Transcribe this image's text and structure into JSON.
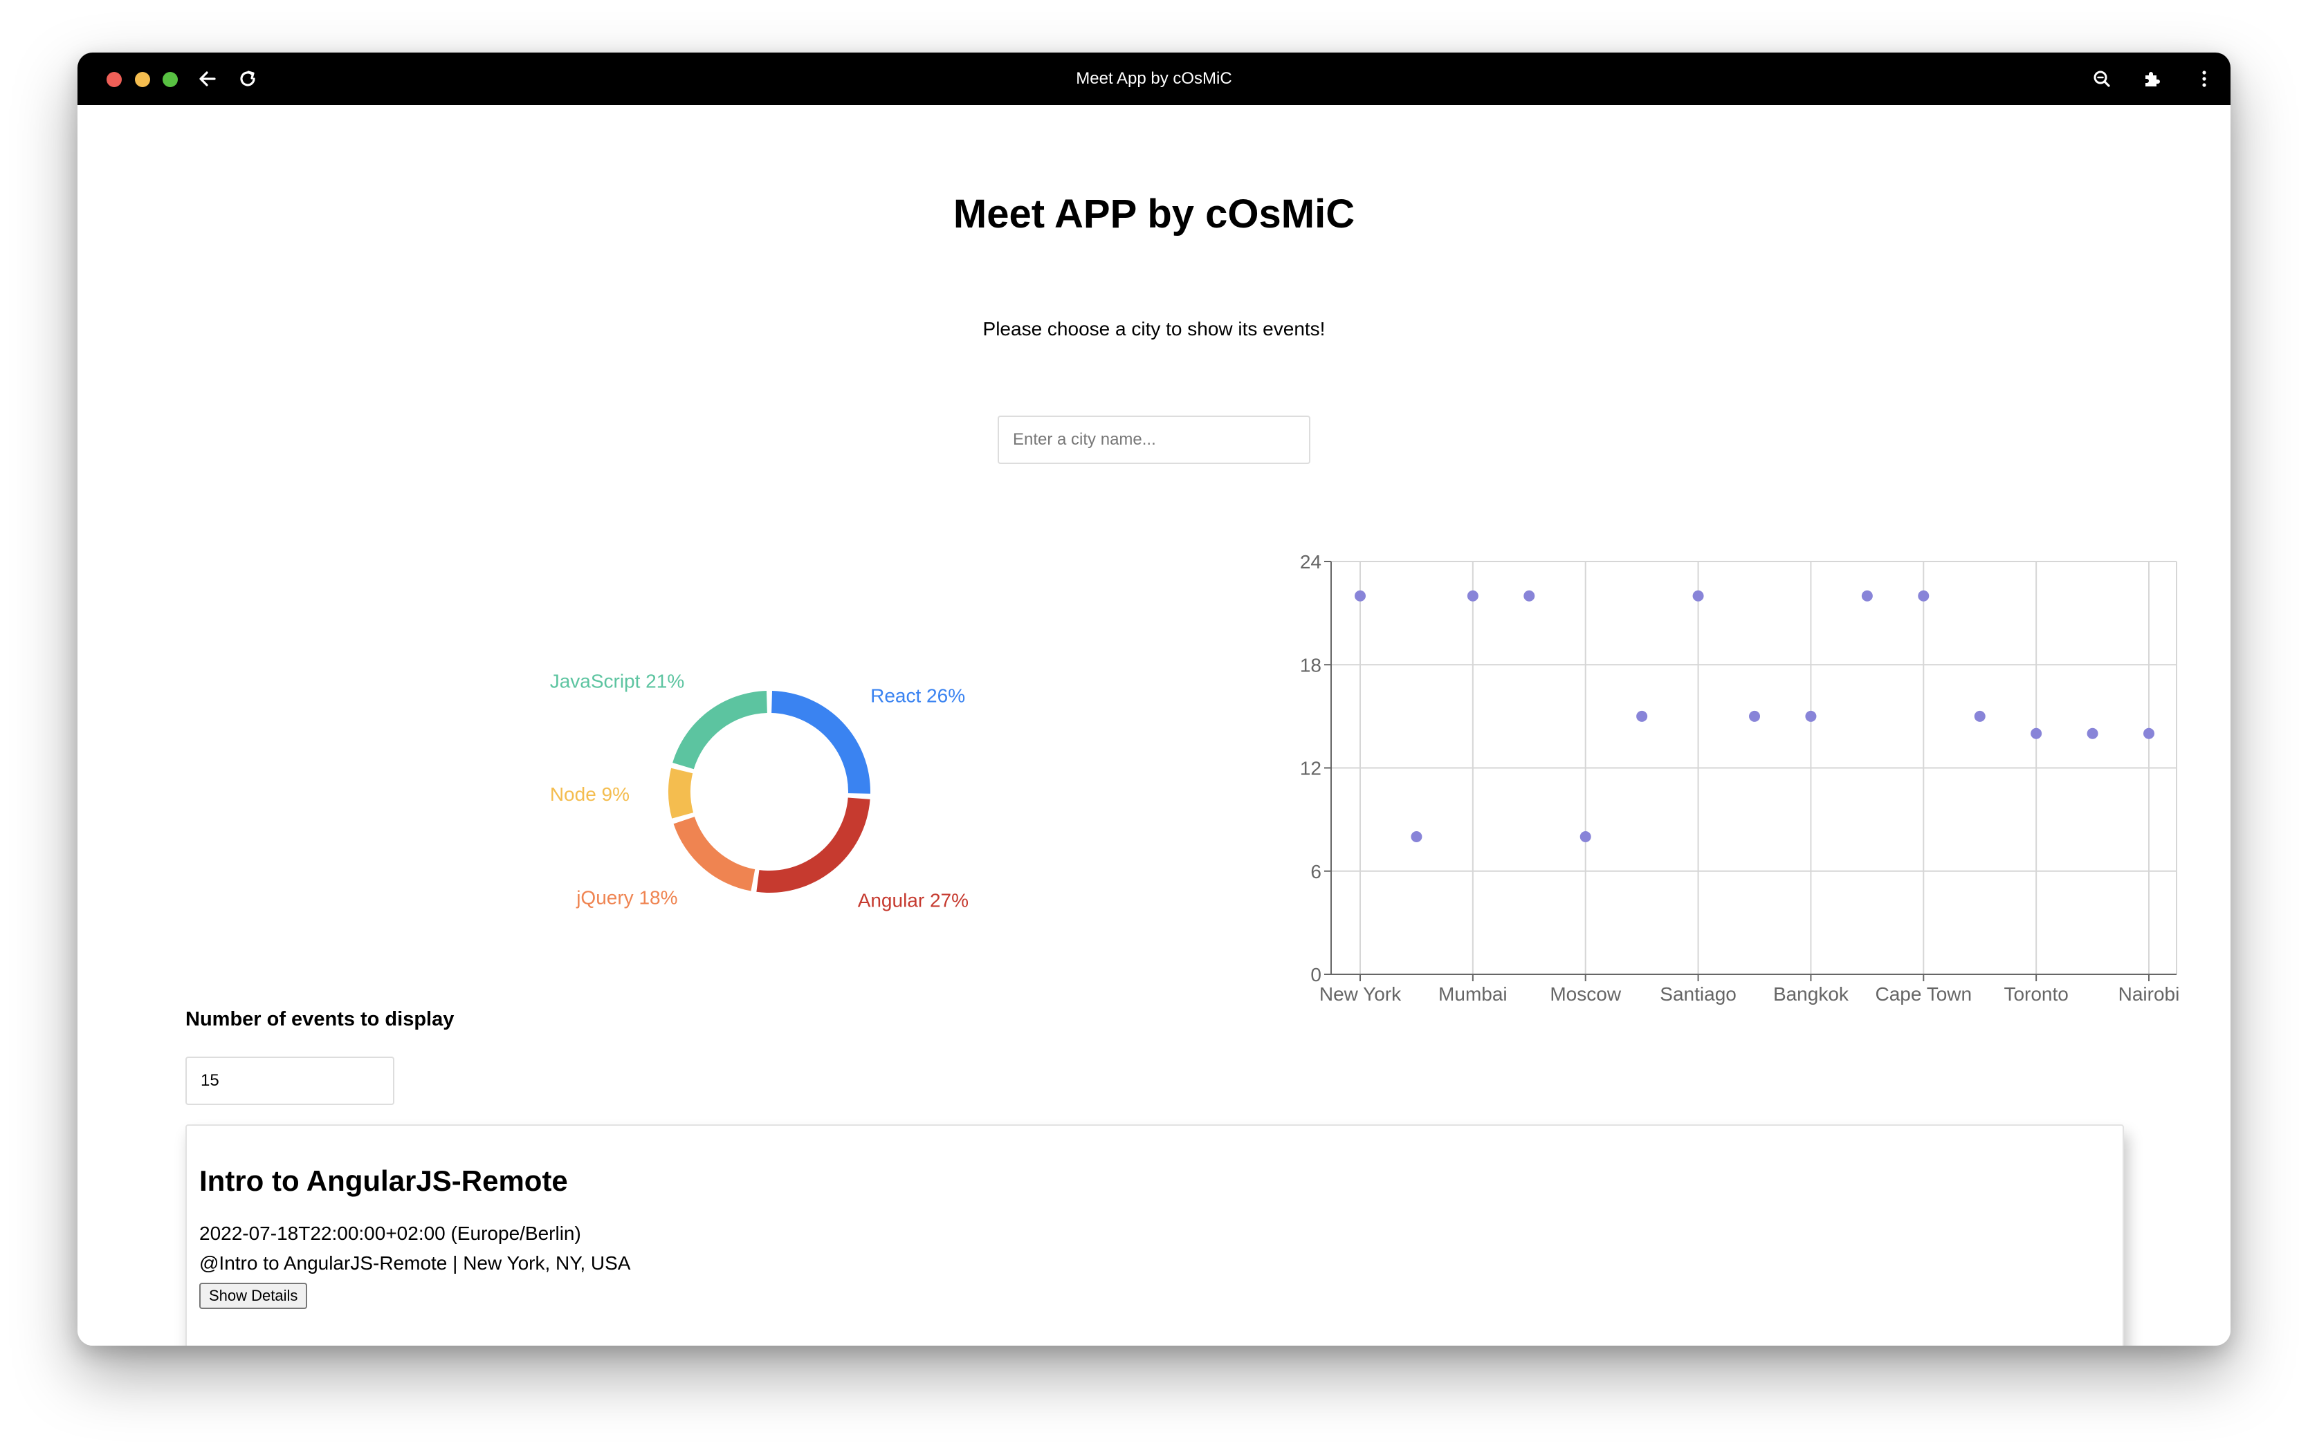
{
  "window": {
    "title": "Meet App by cOsMiC",
    "colors": {
      "close": "#ee5f57",
      "minimize": "#f5bd4f",
      "maximize": "#58c142"
    },
    "toolbar_icons": [
      "back-arrow-icon",
      "reload-icon",
      "zoom-icon",
      "extension-puzzle-icon",
      "more-vertical-icon"
    ]
  },
  "header": {
    "title": "Meet APP by cOsMiC",
    "subtitle": "Please choose a city to show its events!"
  },
  "search": {
    "placeholder": "Enter a city name..."
  },
  "events_count": {
    "label": "Number of events to display",
    "value": "15"
  },
  "events": [
    {
      "title": "Intro to AngularJS-Remote",
      "datetime": "2022-07-18T22:00:00+02:00 (Europe/Berlin)",
      "location": "@Intro to AngularJS-Remote | New York, NY, USA",
      "button": "Show Details"
    }
  ],
  "chart_data": [
    {
      "type": "pie",
      "donut": true,
      "slices": [
        {
          "label": "React 26%",
          "value": 26,
          "color": "#3a83f1"
        },
        {
          "label": "Angular 27%",
          "value": 27,
          "color": "#c63a2f"
        },
        {
          "label": "jQuery 18%",
          "value": 18,
          "color": "#ef8451"
        },
        {
          "label": "Node 9%",
          "value": 9,
          "color": "#f4bd4f"
        },
        {
          "label": "JavaScript 21%",
          "value": 21,
          "color": "#5cc4a0"
        }
      ]
    },
    {
      "type": "scatter",
      "x_ticks": [
        "New York",
        "Mumbai",
        "Moscow",
        "Santiago",
        "Bangkok",
        "Cape Town",
        "Toronto",
        "Nairobi"
      ],
      "y_ticks": [
        0,
        6,
        12,
        18,
        24
      ],
      "ylim": [
        0,
        24
      ],
      "grid": true,
      "point_color": "#8884d8",
      "points": [
        {
          "x": 0,
          "y": 22
        },
        {
          "x": 1,
          "y": 8
        },
        {
          "x": 2,
          "y": 22
        },
        {
          "x": 3,
          "y": 22
        },
        {
          "x": 4,
          "y": 8
        },
        {
          "x": 5,
          "y": 15
        },
        {
          "x": 6,
          "y": 22
        },
        {
          "x": 7,
          "y": 15
        },
        {
          "x": 8,
          "y": 15
        },
        {
          "x": 9,
          "y": 22
        },
        {
          "x": 10,
          "y": 22
        },
        {
          "x": 11,
          "y": 15
        },
        {
          "x": 12,
          "y": 14
        },
        {
          "x": 13,
          "y": 14
        },
        {
          "x": 14,
          "y": 14
        }
      ],
      "x_tick_positions": [
        0,
        2,
        4,
        6,
        8,
        10,
        12,
        14
      ],
      "x_max": 14
    }
  ]
}
